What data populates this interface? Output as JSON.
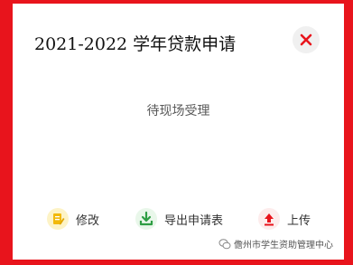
{
  "dialog": {
    "title": "2021-2022 学年贷款申请",
    "status_text": "待现场受理"
  },
  "actions": {
    "edit_label": "修改",
    "export_label": "导出申请表",
    "upload_label": "上传"
  },
  "icons": {
    "close": "close-icon",
    "edit": "edit-document-icon",
    "export": "download-icon",
    "upload": "upload-icon",
    "watermark": "wechat-icon"
  },
  "watermark": {
    "text": "儋州市学生资助管理中心"
  },
  "colors": {
    "frame": "#e8141c",
    "close": "#e8141c",
    "edit": "#f2b90a",
    "export": "#2e9e44",
    "upload": "#e8141c"
  }
}
